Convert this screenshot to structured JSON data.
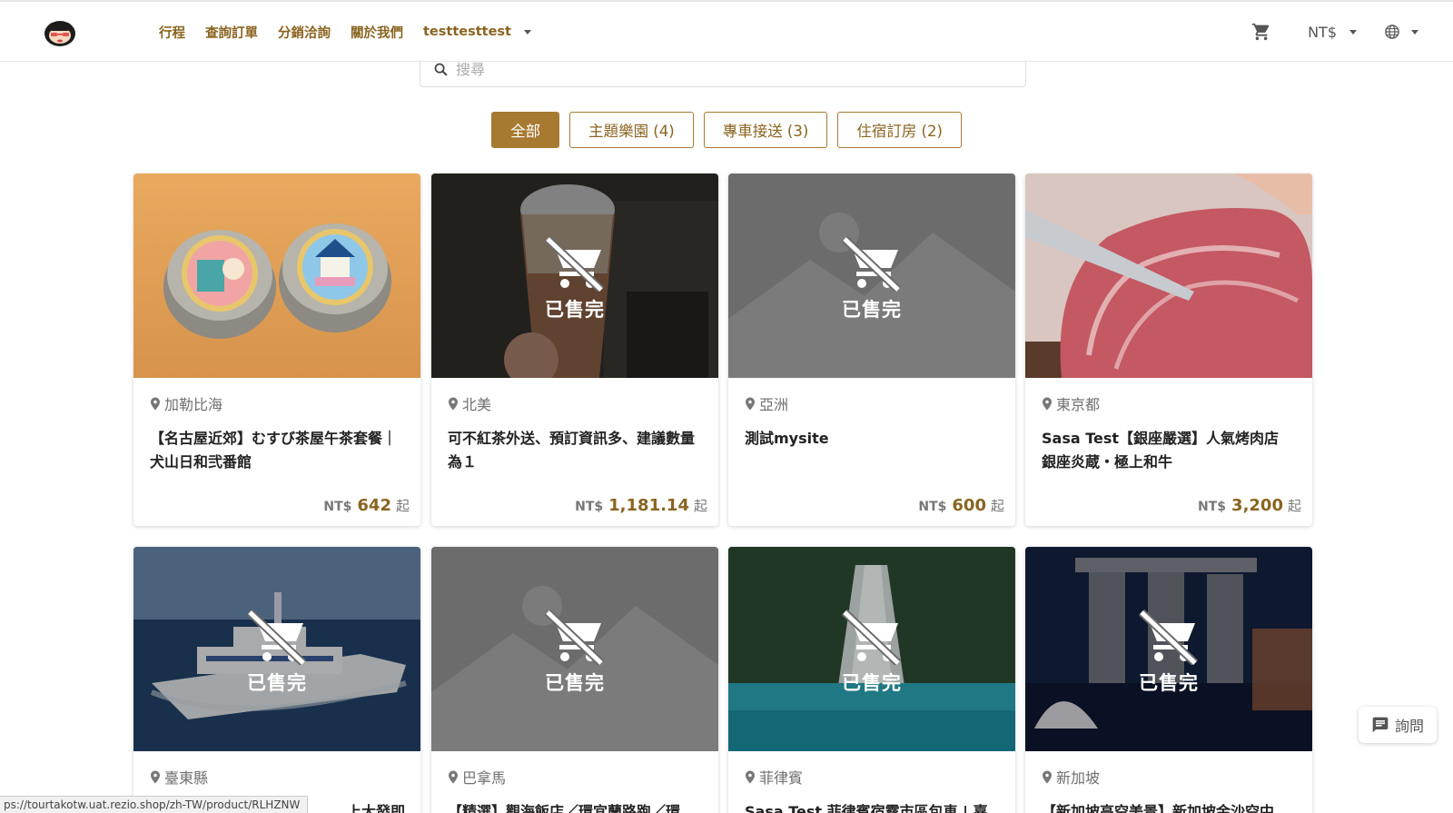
{
  "header": {
    "nav": [
      "行程",
      "查詢訂單",
      "分銷洽詢",
      "關於我們"
    ],
    "user": "testtesttest",
    "currency": "NT$"
  },
  "search": {
    "placeholder": "搜尋"
  },
  "filters": [
    "全部",
    "主題樂園 (4)",
    "專車接送 (3)",
    "住宿訂房 (2)"
  ],
  "sold_out_label": "已售完",
  "price_currency": "NT$",
  "price_suffix": "起",
  "cards": [
    {
      "location": "加勒比海",
      "title": "【名古屋近郊】むすび茶屋午茶套餐｜犬山日和弐番館",
      "price": "642",
      "sold_out": false
    },
    {
      "location": "北美",
      "title": "可不紅茶外送、預訂資訊多、建議數量為１",
      "price": "1,181.14",
      "sold_out": true
    },
    {
      "location": "亞洲",
      "title": "測試mysite",
      "price": "600",
      "sold_out": true
    },
    {
      "location": "東京都",
      "title": "Sasa Test【銀座嚴選】人氣烤肉店 銀座炎蔵・極上和牛",
      "price": "3,200",
      "sold_out": false
    },
    {
      "location": "臺東縣",
      "title": "上大發即",
      "sold_out": true
    },
    {
      "location": "巴拿馬",
      "title": "【精選】觀海飯店／環宜蘭路跑／環",
      "sold_out": true
    },
    {
      "location": "菲律賓",
      "title": "Sasa Test 菲律賓宿霧市區包車 | 嘉",
      "sold_out": true
    },
    {
      "location": "新加坡",
      "title": "【新加坡高空美景】新加坡金沙空中",
      "sold_out": true
    }
  ],
  "inquiry_label": "詢問",
  "status_url": "ps://tourtakotw.uat.rezio.shop/zh-TW/product/RLHZNW",
  "colors": {
    "accent": "#a77a31",
    "accent_text": "#8a6420"
  }
}
